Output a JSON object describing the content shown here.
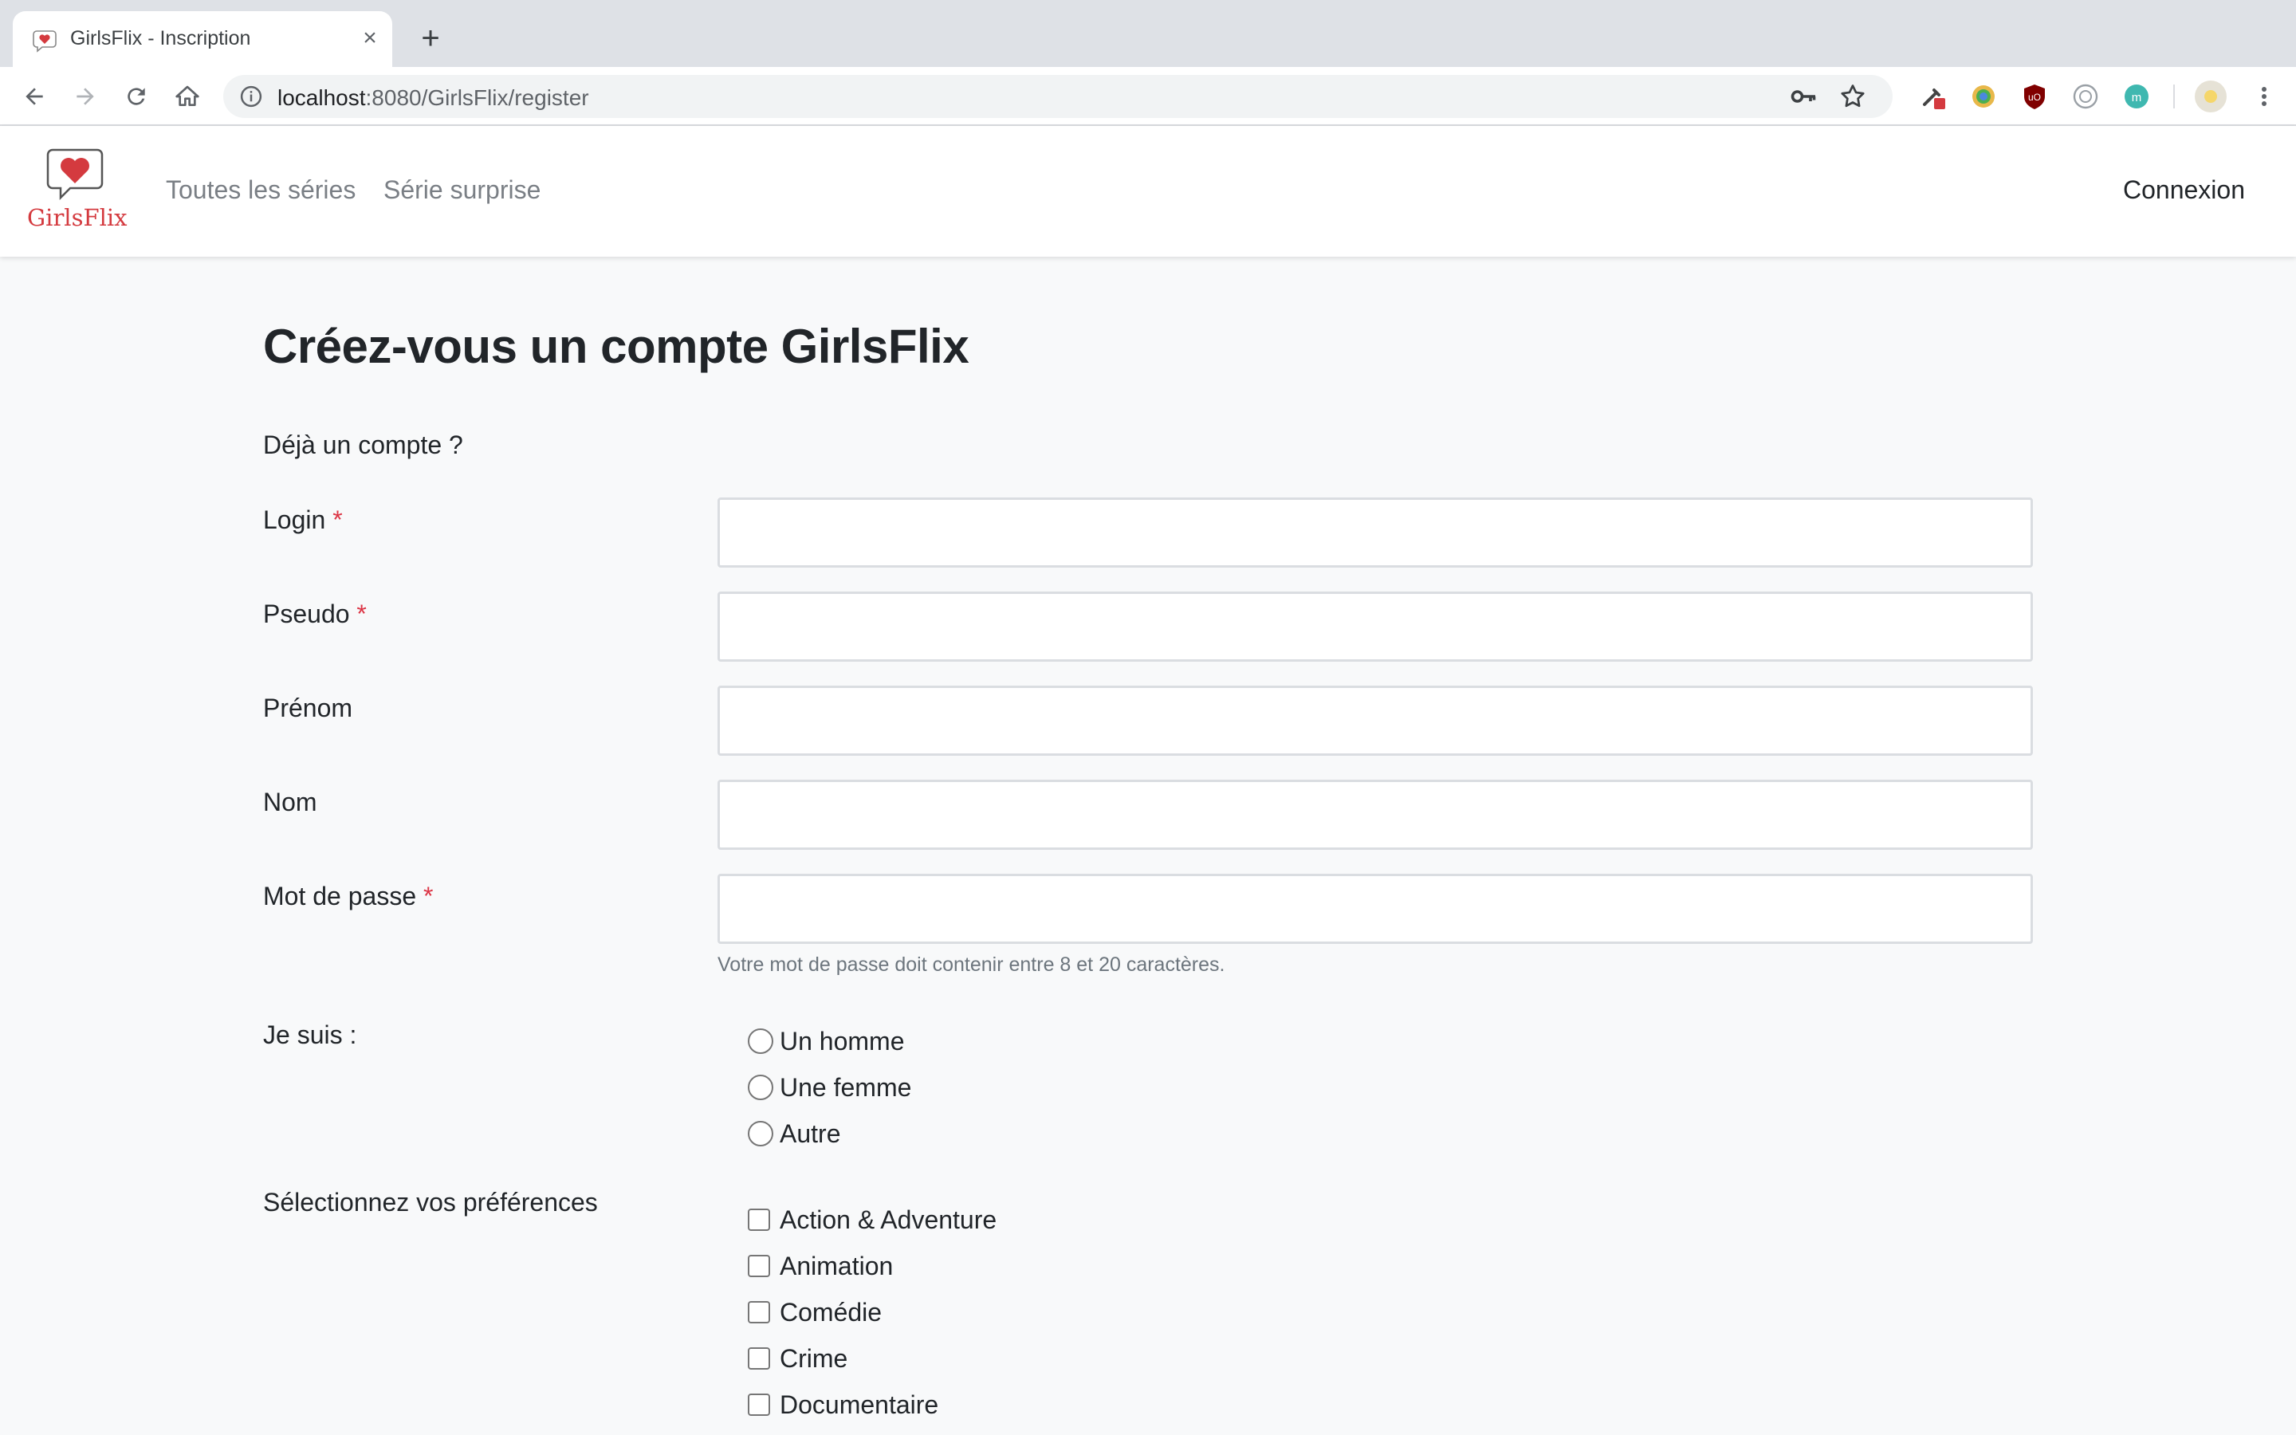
{
  "browser": {
    "tab_title": "GirlsFlix - Inscription",
    "tab_close": "×",
    "new_tab": "+",
    "url_host": "localhost",
    "url_path": ":8080/GirlsFlix/register"
  },
  "site": {
    "brand": "GirlsFlix",
    "nav": {
      "all_series": "Toutes les séries",
      "surprise": "Série surprise",
      "login": "Connexion"
    }
  },
  "form": {
    "title": "Créez-vous un compte GirlsFlix",
    "already": "Déjà un compte ?",
    "required_mark": "*",
    "fields": {
      "login": "Login",
      "pseudo": "Pseudo",
      "firstname": "Prénom",
      "lastname": "Nom",
      "password": "Mot de passe"
    },
    "password_help": "Votre mot de passe doit contenir entre 8 et 20 caractères.",
    "gender_label": "Je suis :",
    "gender_options": [
      "Un homme",
      "Une femme",
      "Autre"
    ],
    "prefs_label": "Sélectionnez vos préférences",
    "prefs_options": [
      "Action & Adventure",
      "Animation",
      "Comédie",
      "Crime",
      "Documentaire"
    ]
  },
  "colors": {
    "brand_red": "#d43a3f",
    "required_red": "#dc3545"
  }
}
